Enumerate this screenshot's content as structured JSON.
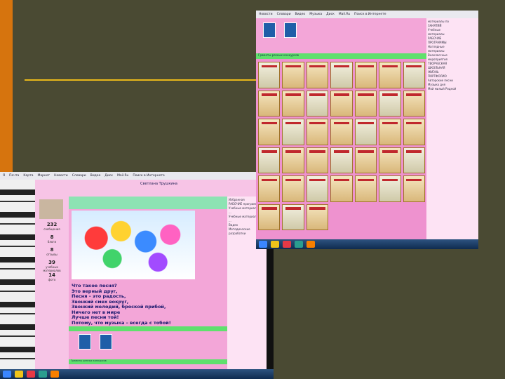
{
  "left_screenshot": {
    "browser_tabs": [
      "Я",
      "Почта",
      "Карта",
      "Маркет",
      "Новости",
      "Словари",
      "Видео",
      "Диск",
      "Mail.Ru",
      "Поиск в Интернете"
    ],
    "site_title": "Светлана Трушкина",
    "profile_stats": [
      {
        "value": "232",
        "label": "сообщения"
      },
      {
        "value": "8",
        "label": "блоги"
      },
      {
        "value": "8",
        "label": "отзывы"
      },
      {
        "value": "39",
        "label": "учебных материалов"
      },
      {
        "value": "14",
        "label": "фото"
      }
    ],
    "poem_lines": [
      "Что такое песня?",
      "Это верный друг,",
      "Песня – это радость,",
      "Звонкий смех вокруг,",
      "Звонкий мелодий, броской прибой,",
      "Ничего нет в мире",
      "Лучше песни той!",
      "Потому, что музыка – всегда с тобой!"
    ],
    "green_strip_label": "Грамоты разных конкурсов",
    "side_items": [
      "Избранная",
      "РАБОЧИЕ программы",
      "Учебные материалы по ...",
      "Учебные материалы по ...",
      "Видео",
      "Методические разработки"
    ]
  },
  "right_screenshot": {
    "browser_tabs": [
      "Новости",
      "Словари",
      "Видео",
      "Музыка",
      "Диск",
      "Mail.Ru",
      "Поиск в Интернете"
    ],
    "band_label": "Грамоты разных конкурсов",
    "side_items": [
      "материалы по",
      "ЗАНЯТИЙ",
      "Учебные",
      "материалы",
      "РАБОЧИЕ",
      "ПРОГРАММЫ",
      "Наглядные",
      "материалы",
      "Внеклассные",
      "мероприятия",
      "ТВОРЧЕСКАЯ",
      "ШКОЛЬНАЯ",
      "ЖИЗНЬ",
      "ПОРТФОЛИО",
      "Авторские песни",
      "Музыка дня",
      "Мой милый Родной"
    ],
    "certificate_rows": 6,
    "certificate_cols": 7
  }
}
